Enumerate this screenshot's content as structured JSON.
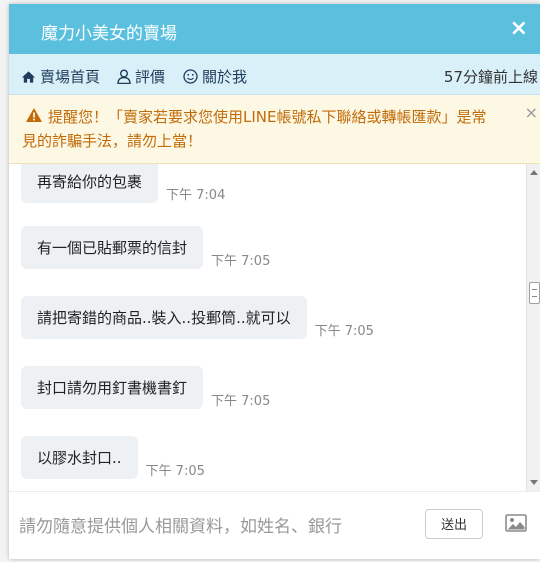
{
  "header": {
    "title": "魔力小美女的賣場",
    "close_symbol": "×"
  },
  "nav": {
    "items": [
      {
        "label": "賣場首頁",
        "icon": "home-icon"
      },
      {
        "label": "評價",
        "icon": "user-icon"
      },
      {
        "label": "關於我",
        "icon": "smile-icon"
      }
    ],
    "last_online": "57分鐘前上線"
  },
  "warning": {
    "line1": "提醒您！「賣家若要求您使用LINE帳號私下聯絡或轉帳匯款」是常",
    "line2": "見的詐騙手法，請勿上當！",
    "close_symbol": "×",
    "icon": "warning-icon"
  },
  "messages": [
    {
      "text": "再寄給你的包裹",
      "time": "下午 7:04"
    },
    {
      "text": "有一個已貼郵票的信封",
      "time": "下午 7:05"
    },
    {
      "text": "請把寄錯的商品..裝入..投郵筒..就可以",
      "time": "下午 7:05"
    },
    {
      "text": "封口請勿用釘書機書釘",
      "time": "下午 7:05"
    },
    {
      "text": "以膠水封口..",
      "time": "下午 7:05"
    }
  ],
  "composer": {
    "placeholder": "請勿隨意提供個人相關資料，如姓名、銀行",
    "send_label": "送出",
    "image_icon": "image-icon"
  },
  "colors": {
    "header": "#5bc0de",
    "nav": "#d9f0f9",
    "warning_bg": "#fcf8e3",
    "warning_text": "#c26b0a",
    "bubble": "#eef1f4"
  }
}
